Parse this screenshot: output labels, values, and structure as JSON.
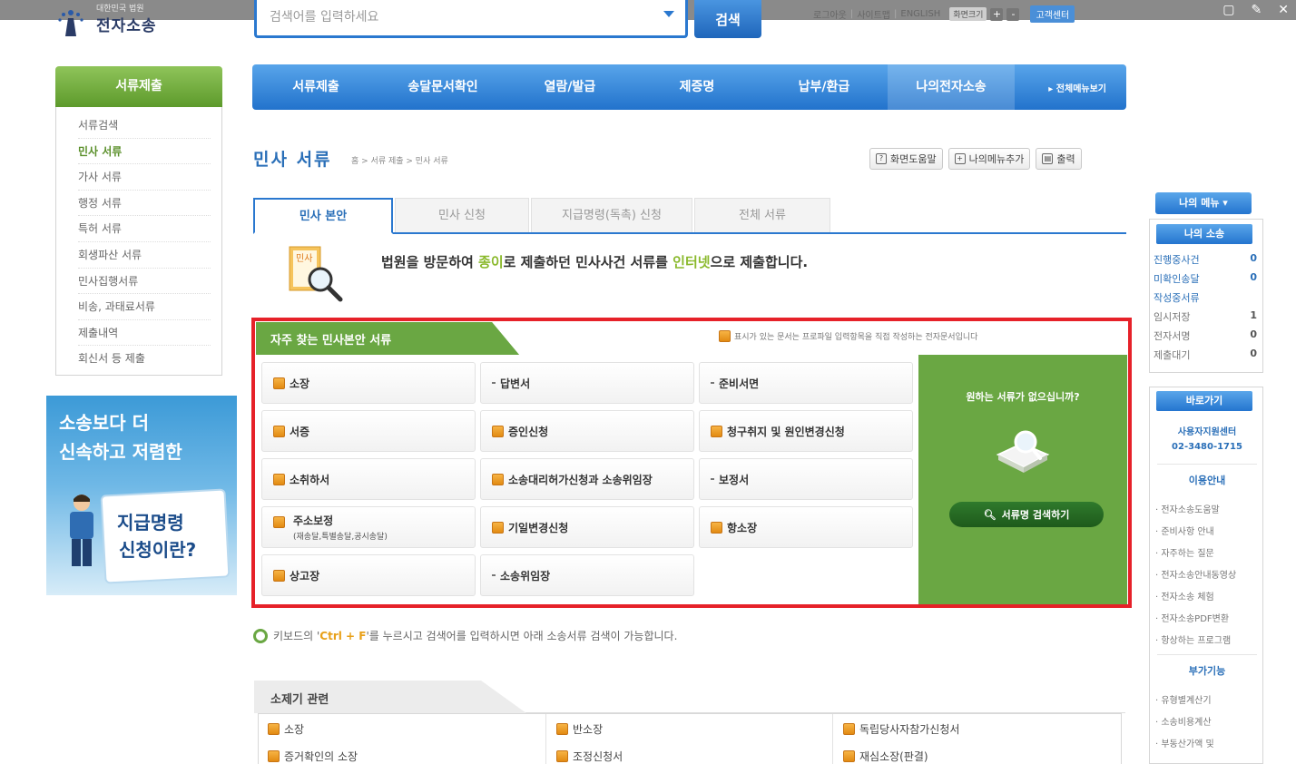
{
  "header": {
    "logo_sub": "대한민국 법원",
    "logo_title": "전자소송",
    "search_placeholder": "검색어를 입력하세요",
    "search_button": "검색",
    "util_links": [
      "로그아웃",
      "사이트맵",
      "ENGLISH"
    ],
    "font_size_label": "화면크기",
    "plus": "+",
    "minus": "-",
    "customer_center": "고객센터"
  },
  "left_sidebar": {
    "header": "서류제출",
    "items": [
      "서류검색",
      "민사 서류",
      "가사 서류",
      "행정 서류",
      "특허 서류",
      "회생파산 서류",
      "민사집행서류",
      "비송, 과태료서류",
      "제출내역",
      "회신서 등 제출"
    ],
    "active_index": 1,
    "banner": {
      "line1": "소송보다 더",
      "line2": "신속하고 저렴한",
      "title1": "지급명령",
      "title2": "신청이란?"
    }
  },
  "main_nav": {
    "items": [
      "서류제출",
      "송달문서확인",
      "열람/발급",
      "제증명",
      "납부/환급",
      "나의전자소송"
    ],
    "active_index": 5,
    "more": "▸ 전체메뉴보기"
  },
  "page": {
    "title": "민사 서류",
    "breadcrumb": "홈 > 서류 제출 > 민사 서류",
    "tools": [
      "화면도움말",
      "나의메뉴추가",
      "출력"
    ]
  },
  "tabs": {
    "items": [
      "민사 본안",
      "민사 신청",
      "지급명령(독촉) 신청",
      "전체 서류"
    ],
    "active_index": 0
  },
  "intro": {
    "icon_label": "민사",
    "text_before": "법원을 방문하여 ",
    "highlight1": "종이",
    "text_mid": "로 제출하던 민사사건 서류를 ",
    "highlight2": "인터넷",
    "text_after": "으로 제출합니다."
  },
  "favorites": {
    "title": "자주 찾는 민사본안 서류",
    "note": "표시가 있는 문서는 프로파일 입력항목을 직접 작성하는 전자문서입니다",
    "items": [
      {
        "label": "소장",
        "icon": "doc"
      },
      {
        "label": "답변서",
        "icon": "dot"
      },
      {
        "label": "준비서면",
        "icon": "dot"
      },
      {
        "label": "서증",
        "icon": "doc"
      },
      {
        "label": "증인신청",
        "icon": "doc"
      },
      {
        "label": "청구취지 및 원인변경신청",
        "icon": "doc"
      },
      {
        "label": "소취하서",
        "icon": "doc"
      },
      {
        "label": "소송대리허가신청과 소송위임장",
        "icon": "doc"
      },
      {
        "label": "보정서",
        "icon": "dot"
      },
      {
        "label": "주소보정",
        "sub": "(재송달,특별송달,공시송달)",
        "icon": "doc"
      },
      {
        "label": "기일변경신청",
        "icon": "doc"
      },
      {
        "label": "항소장",
        "icon": "doc"
      },
      {
        "label": "상고장",
        "icon": "doc"
      },
      {
        "label": "소송위임장",
        "icon": "dot"
      }
    ],
    "side_text": "원하는 서류가 없으십니까?",
    "side_button": "서류명 검색하기"
  },
  "hint": {
    "before": "키보드의 '",
    "key": "Ctrl + F",
    "after": "'를 누르시고 검색어를 입력하시면 아래 소송서류 검색이 가능합니다."
  },
  "bottom": {
    "title": "소제기 관련",
    "col1": [
      "소장",
      "증거확인의 소장"
    ],
    "col2": [
      "반소장",
      "조정신청서"
    ],
    "col3": [
      "독립당사자참가신청서",
      "재심소장(판결)"
    ]
  },
  "right_sidebar": {
    "my_menu": "나의 메뉴 ▾",
    "my_case": "나의 소송",
    "rows": [
      {
        "label": "진행중사건",
        "count": "0",
        "style": "blue"
      },
      {
        "label": "미확인송달",
        "count": "0",
        "style": "blue"
      },
      {
        "label": "작성중서류",
        "count": "",
        "style": "blue"
      },
      {
        "label": "임시저장",
        "count": "1",
        "style": "gray"
      },
      {
        "label": "전자서명",
        "count": "0",
        "style": "gray"
      },
      {
        "label": "제출대기",
        "count": "0",
        "style": "gray"
      }
    ],
    "shortcut": "바로가기",
    "center_label": "사용자지원센터",
    "center_phone": "02-3480-1715",
    "guide_title": "이용안내",
    "guide_links": [
      "전자소송도움말",
      "준비사항 안내",
      "자주하는 질문",
      "전자소송안내동영상",
      "전자소송 체험",
      "전자소송PDF변환",
      "항상하는 프로그램"
    ],
    "extra_title": "부가기능",
    "extra_links": [
      "유형별계산기",
      "소송비용계산",
      "부동산가액 및"
    ]
  }
}
